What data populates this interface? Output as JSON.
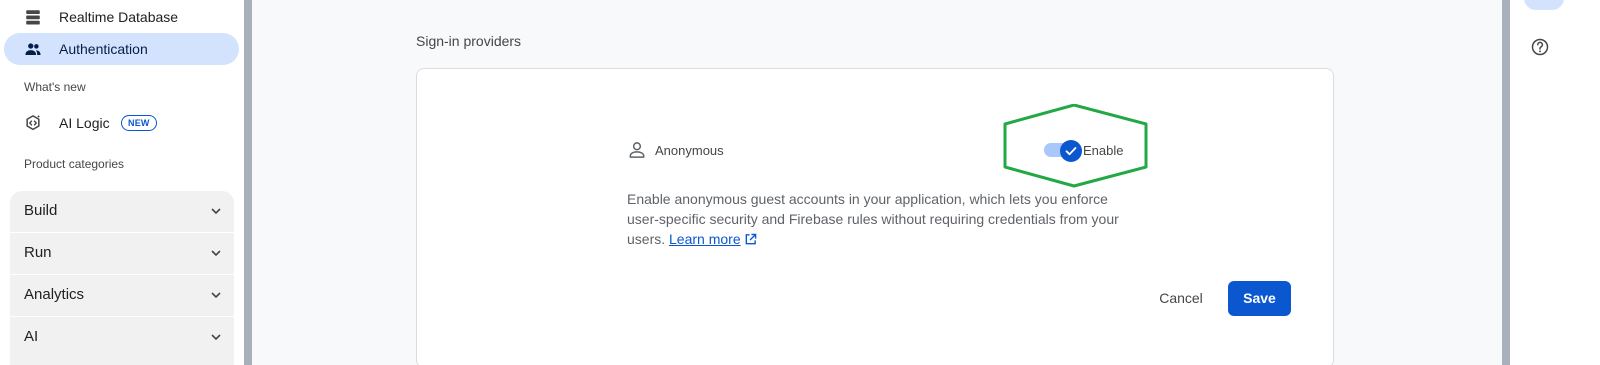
{
  "sidebar": {
    "items": [
      {
        "label": "Realtime Database",
        "icon": "database-icon",
        "active": false
      },
      {
        "label": "Authentication",
        "icon": "people-icon",
        "active": true
      }
    ],
    "whats_new_label": "What's new",
    "ai_logic": {
      "label": "AI Logic",
      "badge": "NEW",
      "icon": "ai-logic-icon"
    },
    "product_categories_label": "Product categories",
    "categories": [
      {
        "label": "Build"
      },
      {
        "label": "Run"
      },
      {
        "label": "Analytics"
      },
      {
        "label": "AI"
      }
    ]
  },
  "main": {
    "heading": "Sign-in providers",
    "provider": {
      "name": "Anonymous",
      "icon": "person-icon",
      "toggle_label": "Enable",
      "enabled": true,
      "description": "Enable anonymous guest accounts in your application, which lets you enforce user-specific security and Firebase rules without requiring credentials from your users.",
      "learn_more": "Learn more"
    },
    "actions": {
      "cancel": "Cancel",
      "save": "Save"
    }
  },
  "colors": {
    "accent": "#0b57d0",
    "active_nav_bg": "#d3e3fd",
    "highlight_outline": "#22a844"
  }
}
